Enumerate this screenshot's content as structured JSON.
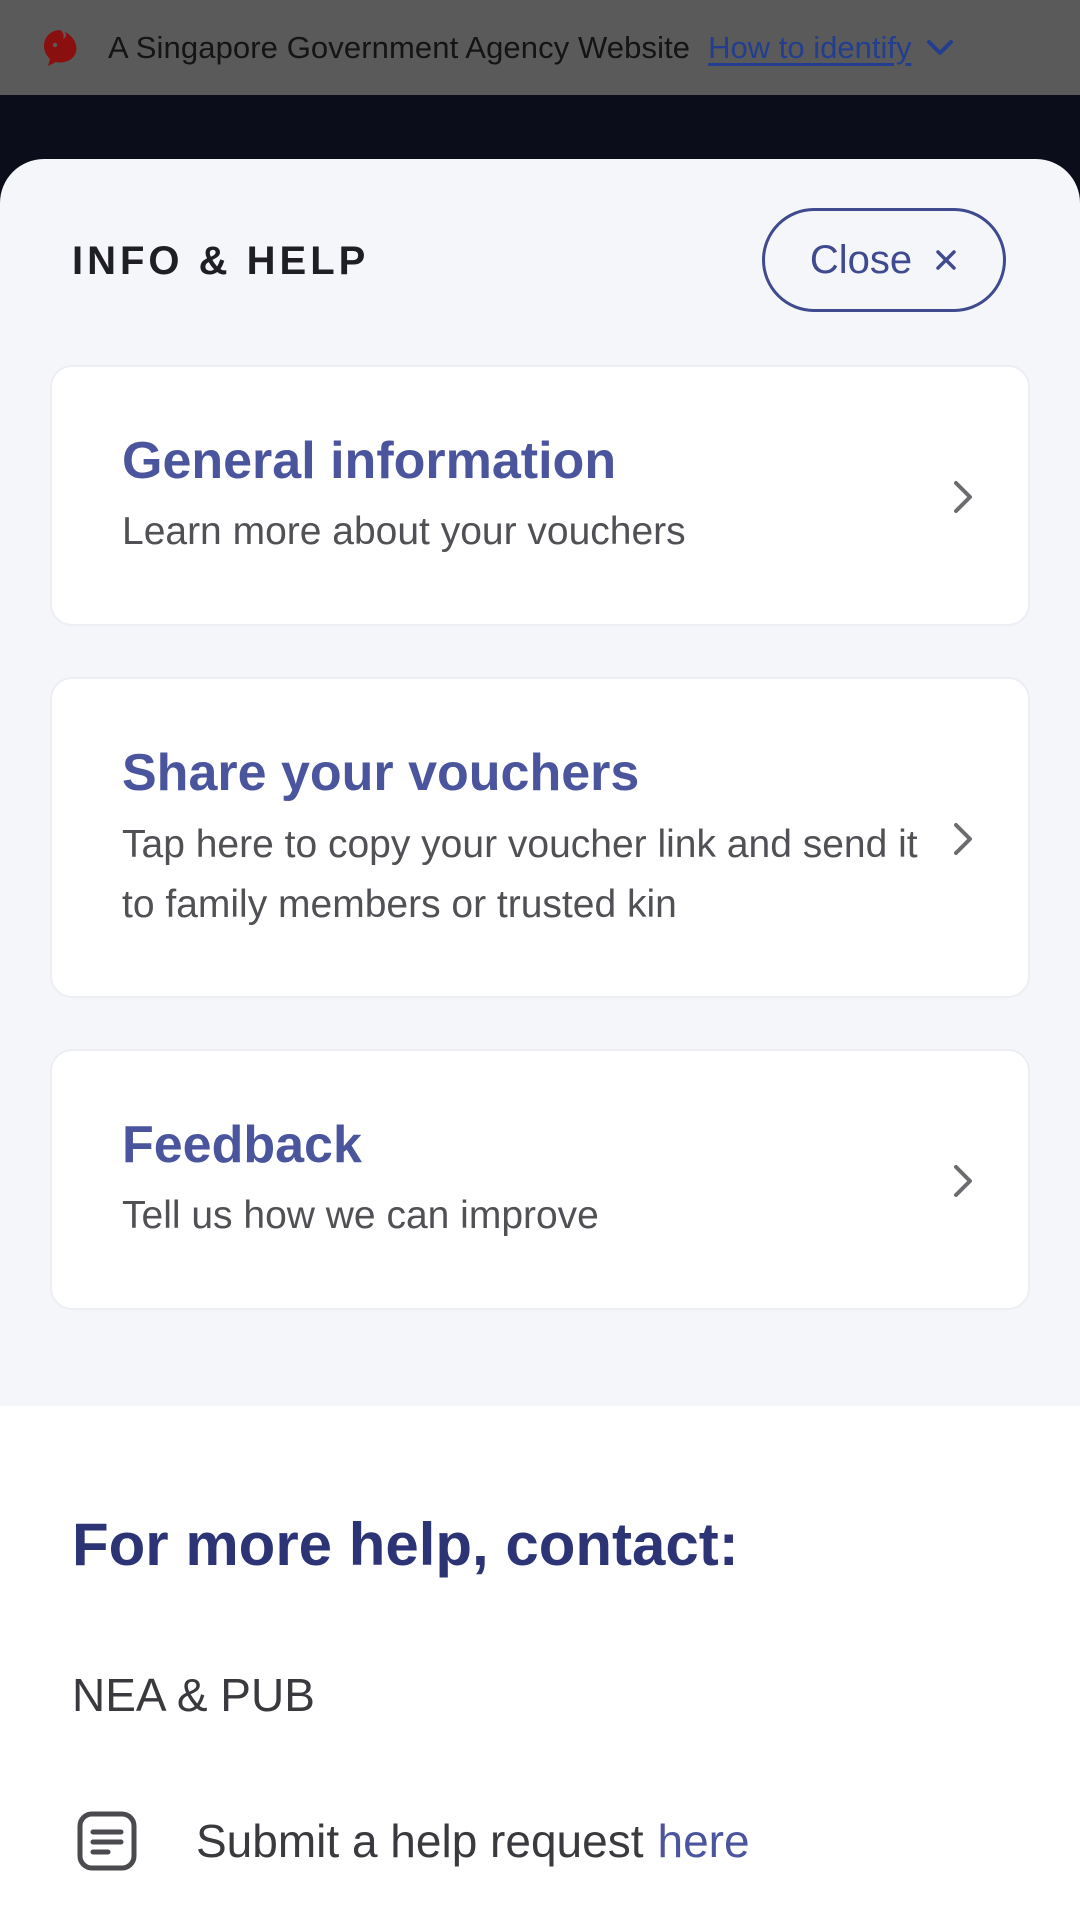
{
  "gov_banner": {
    "agency_text": "A Singapore Government Agency Website",
    "identify_link": "How to identify",
    "icons": [
      "lion-head-icon",
      "chevron-down-icon"
    ]
  },
  "sheet": {
    "header": "INFO & HELP",
    "close_label": "Close",
    "close_icon": "close-icon"
  },
  "cards": [
    {
      "title": "General information",
      "description": "Learn more about your vouchers",
      "icon": "chevron-right-icon"
    },
    {
      "title": "Share your vouchers",
      "description": "Tap here to copy your voucher link and send it to family members or trusted kin",
      "icon": "chevron-right-icon"
    },
    {
      "title": "Feedback",
      "description": "Tell us how we can improve",
      "icon": "chevron-right-icon"
    }
  ],
  "contact": {
    "title": "For more help, contact:",
    "org": "NEA & PUB",
    "help_text": "Submit a help request",
    "help_link": "here",
    "help_icon": "form-icon"
  },
  "colors": {
    "accent": "#4b559e",
    "heading": "#2c3476",
    "sheet_bg": "#f5f6f9",
    "banner_bg": "#5a5a5a"
  }
}
